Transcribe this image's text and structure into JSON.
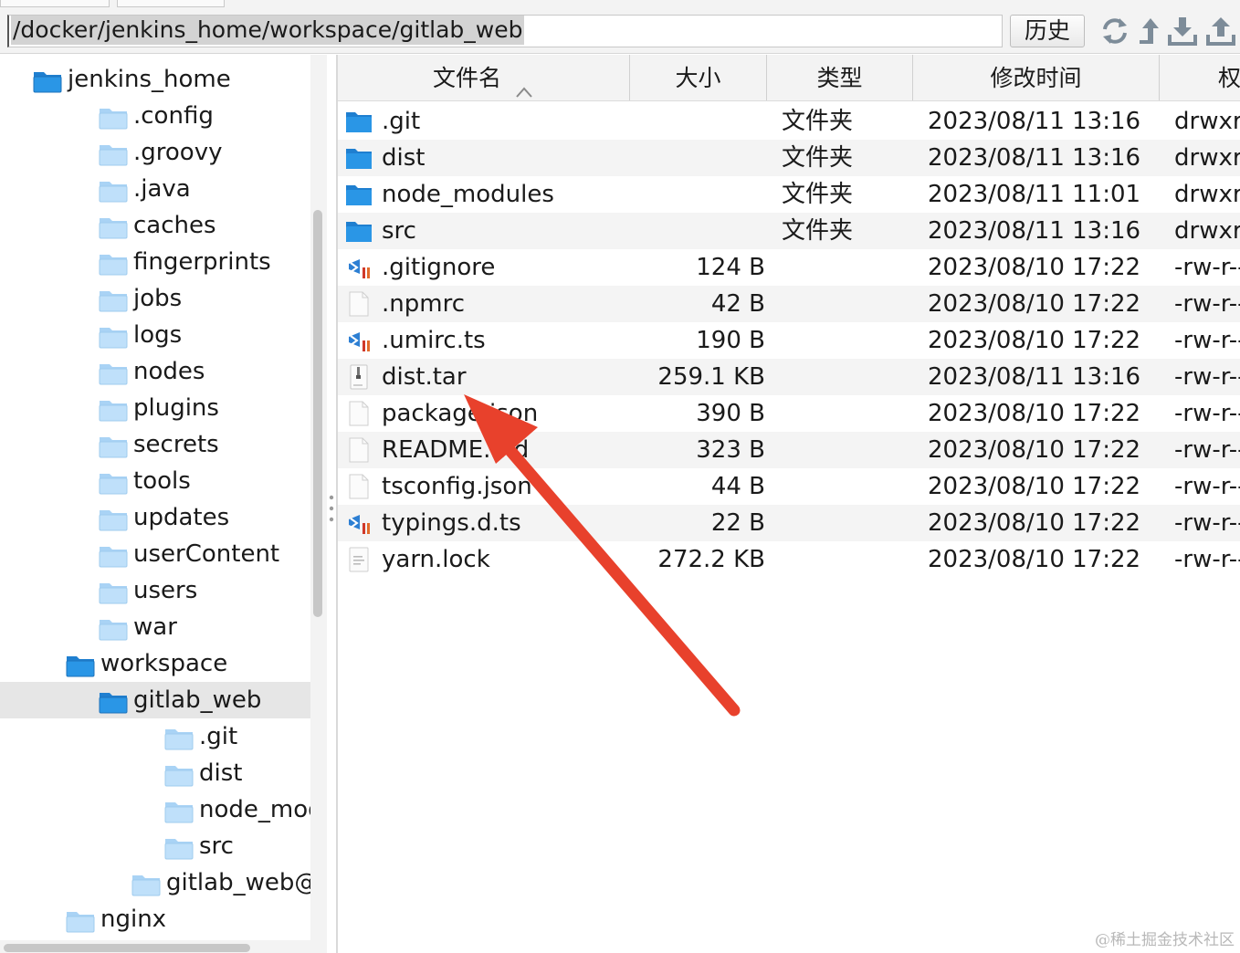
{
  "pathbar": {
    "path": "/docker/jenkins_home/workspace/gitlab_web",
    "history_label": "历史"
  },
  "toolbar_icons": [
    "refresh-icon",
    "up-arrow-icon",
    "download-icon",
    "upload-icon"
  ],
  "tree": {
    "items": [
      {
        "label": "jenkins_home",
        "expanded": true,
        "folder": "dark"
      },
      {
        "label": ".config"
      },
      {
        "label": ".groovy"
      },
      {
        "label": ".java"
      },
      {
        "label": "caches"
      },
      {
        "label": "fingerprints"
      },
      {
        "label": "jobs"
      },
      {
        "label": "logs"
      },
      {
        "label": "nodes"
      },
      {
        "label": "plugins"
      },
      {
        "label": "secrets"
      },
      {
        "label": "tools"
      },
      {
        "label": "updates"
      },
      {
        "label": "userContent"
      },
      {
        "label": "users"
      },
      {
        "label": "war"
      },
      {
        "label": "workspace",
        "expanded": true,
        "folder": "dark"
      },
      {
        "label": "gitlab_web",
        "expanded": true,
        "folder": "dark",
        "selected": true
      },
      {
        "label": ".git"
      },
      {
        "label": "dist"
      },
      {
        "label": "node_modules"
      },
      {
        "label": "src"
      },
      {
        "label": "gitlab_web@tmp"
      },
      {
        "label": "nginx"
      }
    ]
  },
  "table": {
    "columns": [
      "文件名",
      "大小",
      "类型",
      "修改时间",
      "权限"
    ],
    "sort_indicator": "^",
    "rows": [
      {
        "icon": "folder-icon",
        "name": ".git",
        "size": "",
        "type": "文件夹",
        "modified": "2023/08/11 13:16",
        "perm": "drwxr-xr-x"
      },
      {
        "icon": "folder-icon",
        "name": "dist",
        "size": "",
        "type": "文件夹",
        "modified": "2023/08/11 13:16",
        "perm": "drwxr-xr-x"
      },
      {
        "icon": "folder-icon",
        "name": "node_modules",
        "size": "",
        "type": "文件夹",
        "modified": "2023/08/11 11:01",
        "perm": "drwxr-xr-x"
      },
      {
        "icon": "folder-icon",
        "name": "src",
        "size": "",
        "type": "文件夹",
        "modified": "2023/08/11 13:16",
        "perm": "drwxr-xr-x"
      },
      {
        "icon": "vscode-file-icon",
        "name": ".gitignore",
        "size": "124 B",
        "type": "",
        "modified": "2023/08/10 17:22",
        "perm": "-rw-r--r--"
      },
      {
        "icon": "blank-file-icon",
        "name": ".npmrc",
        "size": "42 B",
        "type": "",
        "modified": "2023/08/10 17:22",
        "perm": "-rw-r--r--"
      },
      {
        "icon": "vscode-file-icon",
        "name": ".umirc.ts",
        "size": "190 B",
        "type": "",
        "modified": "2023/08/10 17:22",
        "perm": "-rw-r--r--"
      },
      {
        "icon": "archive-file-icon",
        "name": "dist.tar",
        "size": "259.1 KB",
        "type": "",
        "modified": "2023/08/11 13:16",
        "perm": "-rw-r--r--"
      },
      {
        "icon": "blank-file-icon",
        "name": "package.json",
        "size": "390 B",
        "type": "",
        "modified": "2023/08/10 17:22",
        "perm": "-rw-r--r--"
      },
      {
        "icon": "blank-file-icon",
        "name": "README.md",
        "size": "323 B",
        "type": "",
        "modified": "2023/08/10 17:22",
        "perm": "-rw-r--r--"
      },
      {
        "icon": "blank-file-icon",
        "name": "tsconfig.json",
        "size": "44 B",
        "type": "",
        "modified": "2023/08/10 17:22",
        "perm": "-rw-r--r--"
      },
      {
        "icon": "vscode-file-icon",
        "name": "typings.d.ts",
        "size": "22 B",
        "type": "",
        "modified": "2023/08/10 17:22",
        "perm": "-rw-r--r--"
      },
      {
        "icon": "text-file-icon",
        "name": "yarn.lock",
        "size": "272.2 KB",
        "type": "",
        "modified": "2023/08/10 17:22",
        "perm": "-rw-r--r--"
      }
    ]
  },
  "annotation": {
    "type": "red-arrow",
    "points_to": "dist.tar",
    "color": "#e8412c"
  },
  "watermark": "@稀土掘金技术社区",
  "colors": {
    "folder_dark": "#2a96e6",
    "folder_light": "#bfe0fa",
    "header_bg": "#f3f3f3",
    "alt_row": "#f4f4f4",
    "selection": "#e6e6e6"
  }
}
